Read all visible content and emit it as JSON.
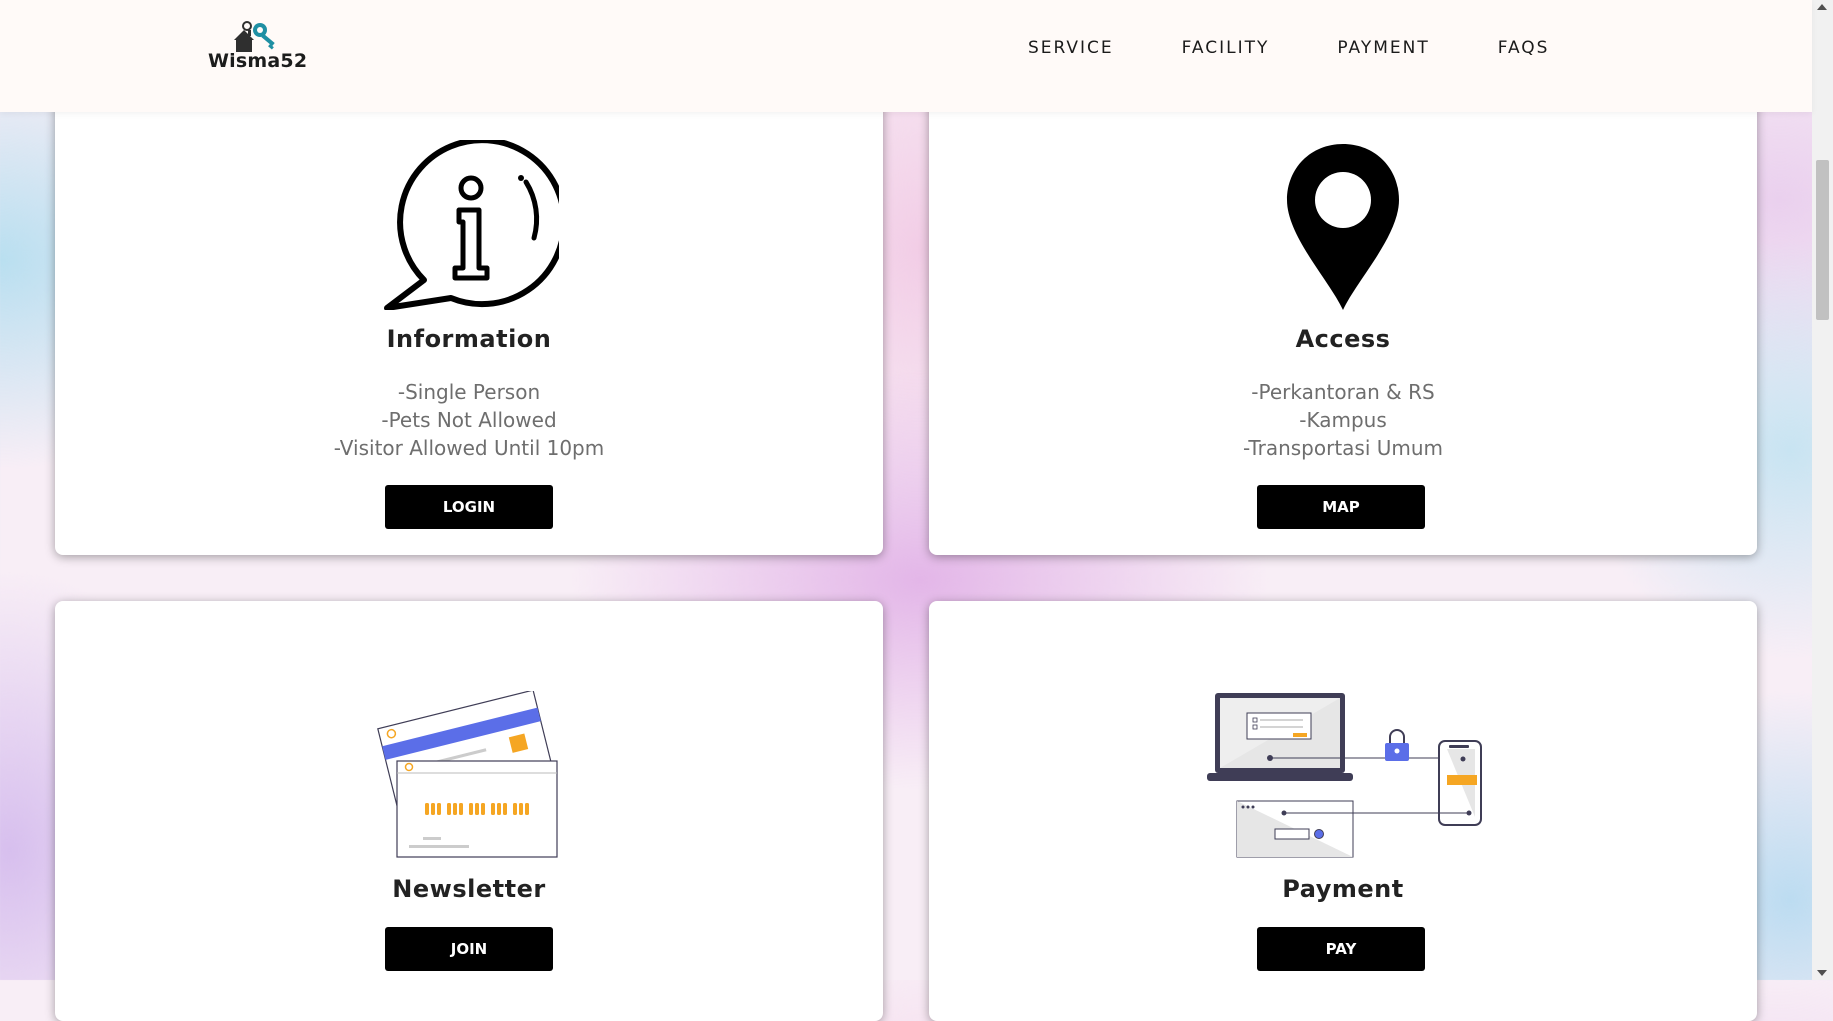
{
  "header": {
    "logo_text": "Wisma52",
    "nav": [
      "SERVICE",
      "FACILITY",
      "PAYMENT",
      "FAQS"
    ]
  },
  "cards": {
    "information": {
      "title": "Information",
      "lines": [
        "-Single Person",
        "-Pets Not Allowed",
        "-Visitor Allowed Until 10pm"
      ],
      "button": "LOGIN",
      "icon": "info-chat-icon"
    },
    "access": {
      "title": "Access",
      "lines": [
        "-Perkantoran & RS",
        "-Kampus",
        "-Transportasi Umum"
      ],
      "button": "MAP",
      "icon": "map-pin-icon"
    },
    "newsletter": {
      "title": "Newsletter",
      "button": "JOIN",
      "icon": "credit-cards-illustration"
    },
    "payment": {
      "title": "Payment",
      "button": "PAY",
      "icon": "online-payment-illustration"
    }
  },
  "colors": {
    "button_bg": "#000000",
    "accent_blue": "#5b6ee8",
    "accent_orange": "#f5a623",
    "dark_device": "#3f3d56"
  }
}
